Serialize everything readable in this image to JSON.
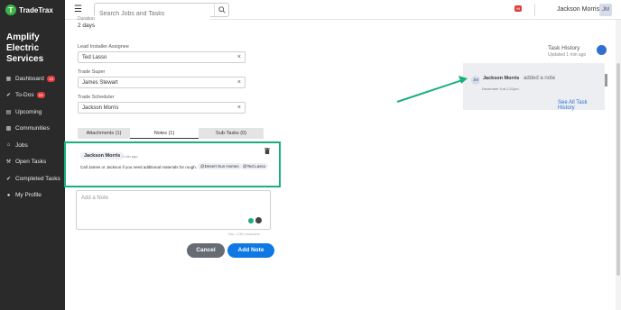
{
  "brand": {
    "name": "TradeTrax",
    "logo_letter": "T"
  },
  "header": {
    "search_placeholder": "Search Jobs and Tasks",
    "notification_count": "99",
    "user_name": "Jackson Morris",
    "user_initials": "JM"
  },
  "sidebar": {
    "company": [
      "Amplify",
      "Electric",
      "Services"
    ],
    "items": [
      {
        "label": "Dashboard",
        "icon": "dashboard-icon",
        "badge": "13"
      },
      {
        "label": "To-Dos",
        "icon": "check-circle-icon",
        "badge": "15"
      },
      {
        "label": "Upcoming",
        "icon": "calendar-icon",
        "badge": ""
      },
      {
        "label": "Communities",
        "icon": "building-icon",
        "badge": ""
      },
      {
        "label": "Jobs",
        "icon": "home-icon",
        "badge": ""
      },
      {
        "label": "Open Tasks",
        "icon": "wrench-icon",
        "badge": ""
      },
      {
        "label": "Completed Tasks",
        "icon": "check-circle-icon",
        "badge": ""
      },
      {
        "label": "My Profile",
        "icon": "user-circle-icon",
        "badge": ""
      }
    ]
  },
  "task": {
    "duration_label": "Duration",
    "duration_value": "2 days",
    "lead_installer_label": "Lead Installer Assignee",
    "lead_installer_value": "Ted Lasso",
    "trade_super_label": "Trade Super",
    "trade_super_value": "James Stewart",
    "trade_scheduler_label": "Trade Scheduler",
    "trade_scheduler_value": "Jackson Morris"
  },
  "tabs": {
    "attachments": "Attachments (1)",
    "notes": "Notes (1)",
    "subtasks": "Sub-Tasks (0)"
  },
  "note": {
    "author": "Jackson Morris",
    "time": "1 min ago",
    "text": "Call James or Jackson if you need additional materials for rough.",
    "tags": [
      "@Desert Sun Homes",
      "@Ted Lasso"
    ]
  },
  "add_note": {
    "placeholder": "Add a Note",
    "char_count": "Max. 1,000 characters",
    "cancel_label": "Cancel",
    "submit_label": "Add Note"
  },
  "task_history": {
    "title": "Task History",
    "updated": "Updated 1 min ago",
    "entry_initials": "JM",
    "entry_name": "Jackson Morris",
    "entry_action": "added a note",
    "entry_date": "December 5 at 2:22pm",
    "see_all": "See All Task History"
  },
  "colors": {
    "sidebar_bg": "#2a2a2a",
    "highlight_green": "#19b079",
    "primary_blue": "#0f78e4",
    "badge_red": "#e03b3b"
  }
}
